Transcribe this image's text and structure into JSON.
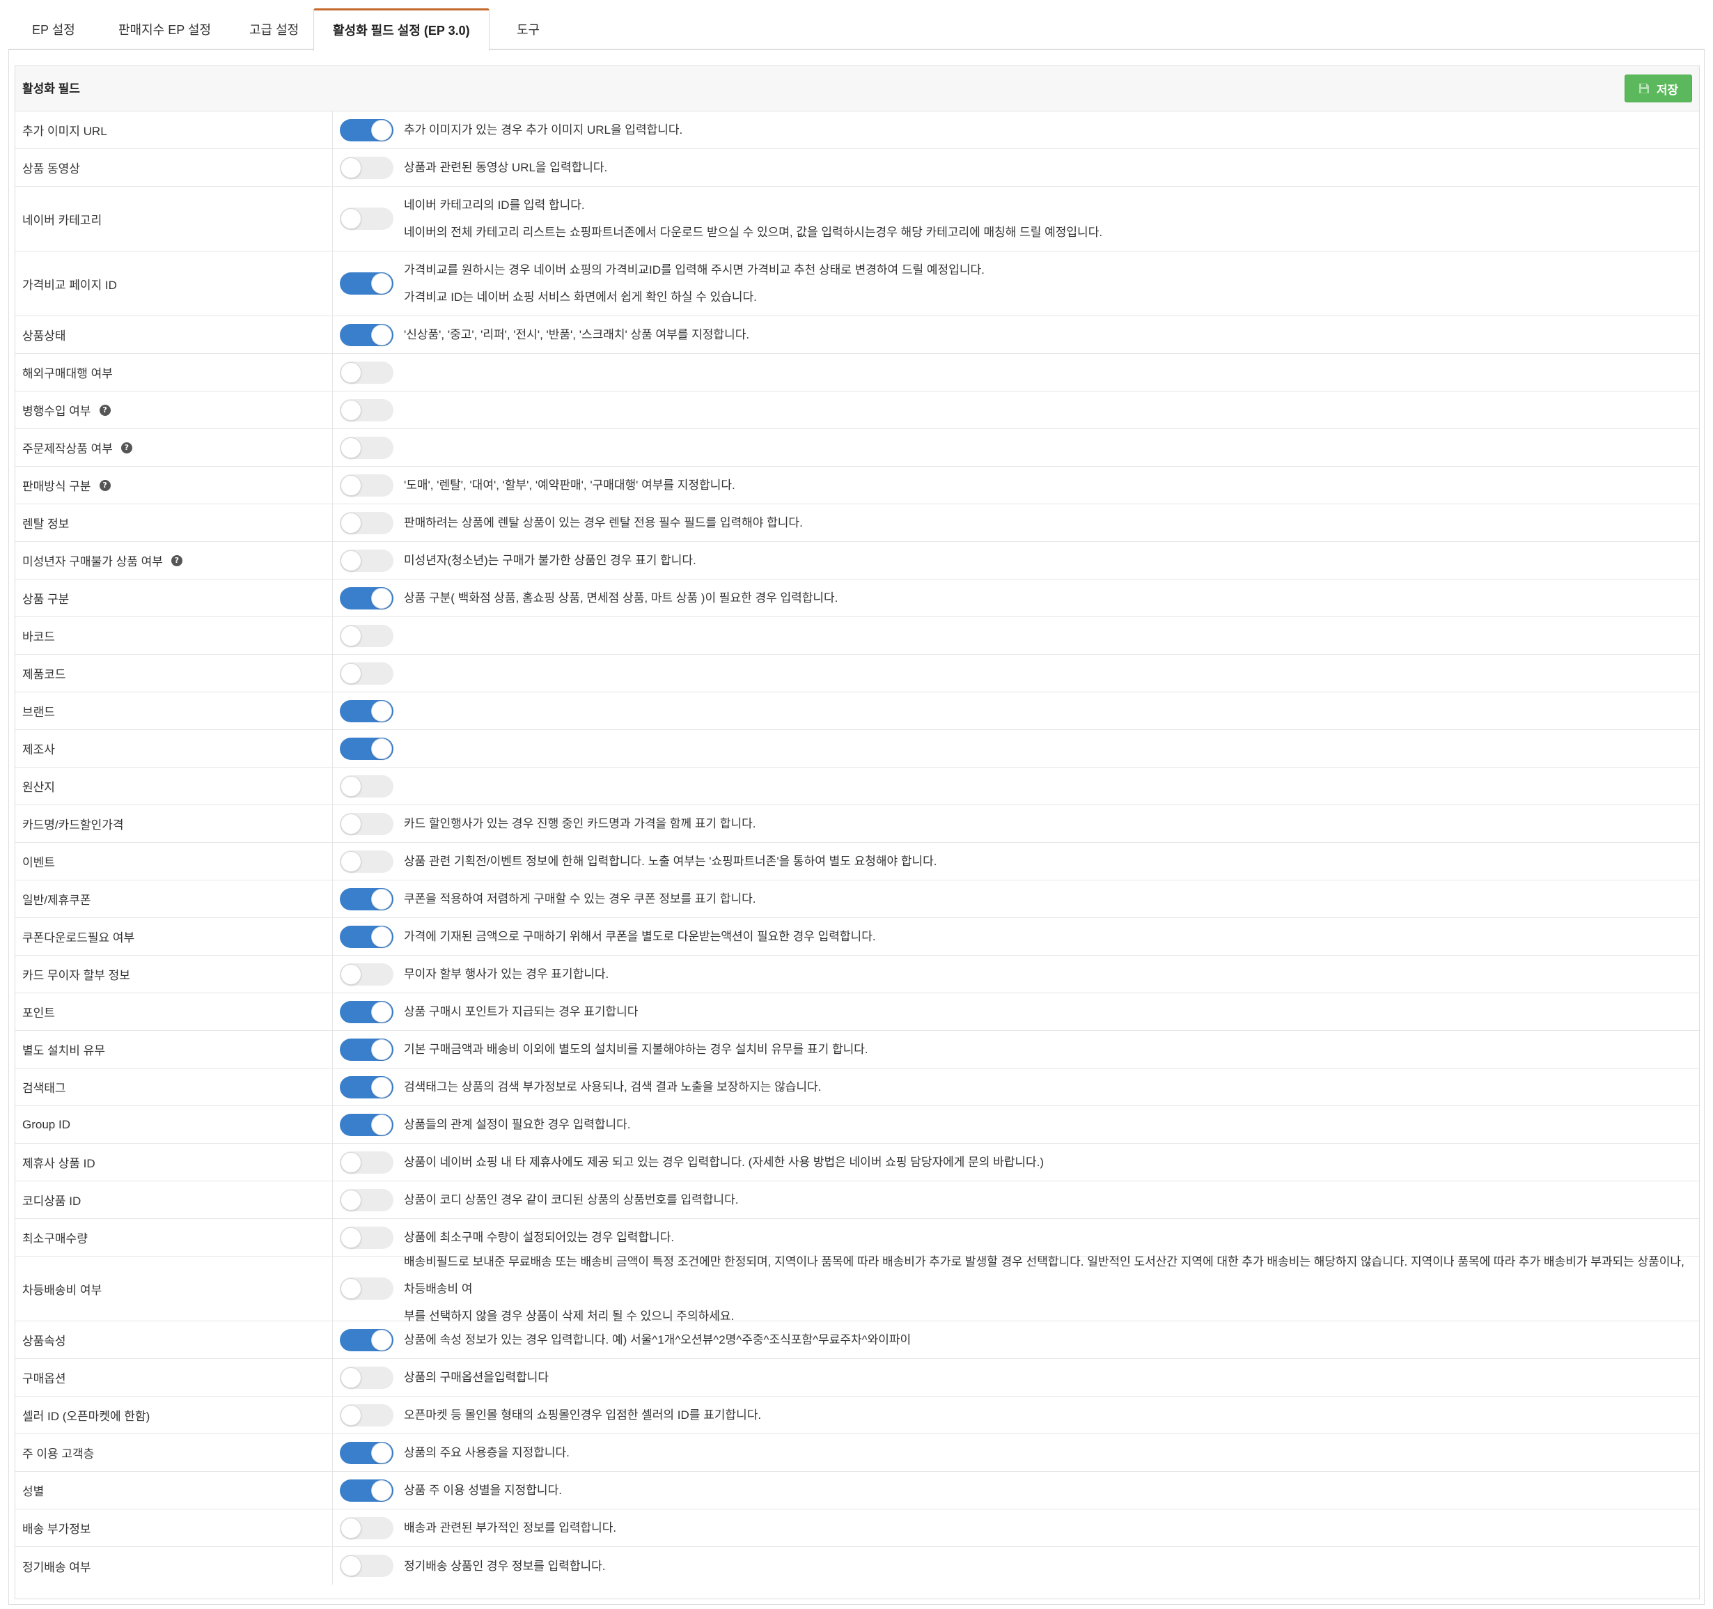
{
  "tabs": [
    {
      "label": "EP 설정",
      "active": false
    },
    {
      "label": "판매지수 EP 설정",
      "active": false
    },
    {
      "label": "고급 설정",
      "active": false
    },
    {
      "label": "활성화 필드 설정 (EP 3.0)",
      "active": true
    },
    {
      "label": "도구",
      "active": false
    }
  ],
  "panel": {
    "title": "활성화 필드",
    "save_label": "저장",
    "save_icon": "floppy-disk-icon",
    "save_color": "#5cb85c",
    "toggle_on_color": "#3a7fcc"
  },
  "fields": [
    {
      "label": "추가 이미지 URL",
      "on": true,
      "help": false,
      "desc": [
        "추가 이미지가 있는 경우 추가 이미지 URL을 입력합니다."
      ]
    },
    {
      "label": "상품 동영상",
      "on": false,
      "help": false,
      "desc": [
        "상품과 관련된 동영상 URL을 입력합니다."
      ]
    },
    {
      "label": "네이버 카테고리",
      "on": false,
      "help": false,
      "desc": [
        "네이버 카테고리의 ID를 입력 합니다.",
        "네이버의 전체 카테고리 리스트는 쇼핑파트너존에서 다운로드 받으실 수 있으며, 값을 입력하시는경우 해당 카테고리에 매칭해 드릴 예정입니다."
      ]
    },
    {
      "label": "가격비교 페이지 ID",
      "on": true,
      "help": false,
      "desc": [
        "가격비교를 원하시는 경우 네이버 쇼핑의 가격비교ID를 입력해 주시면 가격비교 추천 상태로 변경하여 드릴 예정입니다.",
        "가격비교 ID는 네이버 쇼핑 서비스 화면에서 쉽게 확인 하실 수 있습니다."
      ]
    },
    {
      "label": "상품상태",
      "on": true,
      "help": false,
      "desc": [
        "'신상품', '중고', '리퍼', '전시', '반품', '스크래치' 상품 여부를 지정합니다."
      ]
    },
    {
      "label": "해외구매대행 여부",
      "on": false,
      "help": false,
      "desc": []
    },
    {
      "label": "병행수입 여부",
      "on": false,
      "help": true,
      "desc": []
    },
    {
      "label": "주문제작상품 여부",
      "on": false,
      "help": true,
      "desc": []
    },
    {
      "label": "판매방식 구분",
      "on": false,
      "help": true,
      "desc": [
        "'도매', '렌탈', '대여', '할부', '예약판매', '구매대행' 여부를 지정합니다."
      ]
    },
    {
      "label": "렌탈 정보",
      "on": false,
      "help": false,
      "desc": [
        "판매하려는 상품에 렌탈 상품이 있는 경우 렌탈 전용 필수 필드를 입력해야 합니다."
      ]
    },
    {
      "label": "미성년자 구매불가 상품 여부",
      "on": false,
      "help": true,
      "desc": [
        "미성년자(청소년)는 구매가 불가한 상품인 경우 표기 합니다."
      ]
    },
    {
      "label": "상품 구분",
      "on": true,
      "help": false,
      "desc": [
        "상품 구분( 백화점 상품, 홈쇼핑 상품, 면세점 상품, 마트 상품 )이 필요한 경우 입력합니다."
      ]
    },
    {
      "label": "바코드",
      "on": false,
      "help": false,
      "desc": []
    },
    {
      "label": "제품코드",
      "on": false,
      "help": false,
      "desc": []
    },
    {
      "label": "브랜드",
      "on": true,
      "help": false,
      "desc": []
    },
    {
      "label": "제조사",
      "on": true,
      "help": false,
      "desc": []
    },
    {
      "label": "원산지",
      "on": false,
      "help": false,
      "desc": []
    },
    {
      "label": "카드명/카드할인가격",
      "on": false,
      "help": false,
      "desc": [
        "카드 할인행사가 있는 경우 진행 중인 카드명과 가격을 함께 표기 합니다."
      ]
    },
    {
      "label": "이벤트",
      "on": false,
      "help": false,
      "desc": [
        "상품 관련 기획전/이벤트 정보에 한해 입력합니다. 노출 여부는 '쇼핑파트너존'을 통하여 별도 요청해야 합니다."
      ]
    },
    {
      "label": "일반/제휴쿠폰",
      "on": true,
      "help": false,
      "desc": [
        "쿠폰을 적용하여 저렴하게 구매할 수 있는 경우 쿠폰 정보를 표기 합니다."
      ]
    },
    {
      "label": "쿠폰다운로드필요 여부",
      "on": true,
      "help": false,
      "desc": [
        "가격에 기재된 금액으로 구매하기 위해서 쿠폰을 별도로 다운받는액션이 필요한 경우 입력합니다."
      ]
    },
    {
      "label": "카드 무이자 할부 정보",
      "on": false,
      "help": false,
      "desc": [
        "무이자 할부 행사가 있는 경우 표기합니다."
      ]
    },
    {
      "label": "포인트",
      "on": true,
      "help": false,
      "desc": [
        "상품 구매시 포인트가 지급되는 경우 표기합니다"
      ]
    },
    {
      "label": "별도 설치비 유무",
      "on": true,
      "help": false,
      "desc": [
        "기본 구매금액과 배송비 이외에 별도의 설치비를 지불해야하는 경우 설치비 유무를 표기 합니다."
      ]
    },
    {
      "label": "검색태그",
      "on": true,
      "help": false,
      "desc": [
        "검색태그는 상품의 검색 부가정보로 사용되나, 검색 결과 노출을 보장하지는 않습니다."
      ]
    },
    {
      "label": "Group ID",
      "on": true,
      "help": false,
      "desc": [
        "상품들의 관계 설정이 필요한 경우 입력합니다."
      ]
    },
    {
      "label": "제휴사 상품 ID",
      "on": false,
      "help": false,
      "desc": [
        "상품이 네이버 쇼핑 내 타 제휴사에도 제공 되고 있는 경우 입력합니다. (자세한 사용 방법은 네이버 쇼핑 담당자에게 문의 바랍니다.)"
      ]
    },
    {
      "label": "코디상품 ID",
      "on": false,
      "help": false,
      "desc": [
        "상품이 코디 상품인 경우 같이 코디된 상품의 상품번호를 입력합니다."
      ]
    },
    {
      "label": "최소구매수량",
      "on": false,
      "help": false,
      "desc": [
        "상품에 최소구매 수량이 설정되어있는 경우 입력합니다."
      ]
    },
    {
      "label": "차등배송비 여부",
      "on": false,
      "help": false,
      "desc": [
        "배송비필드로 보내준 무료배송 또는 배송비 금액이 특정 조건에만 한정되며, 지역이나 품목에 따라 배송비가 추가로 발생할 경우 선택합니다. 일반적인 도서산간 지역에 대한 추가 배송비는 해당하지 않습니다. 지역이나 품목에 따라 추가 배송비가 부과되는 상품이나, 차등배송비 여",
        "부를 선택하지 않을 경우 상품이 삭제 처리 될 수 있으니 주의하세요."
      ]
    },
    {
      "label": "상품속성",
      "on": true,
      "help": false,
      "desc": [
        "상품에 속성 정보가 있는 경우 입력합니다. 예) 서울^1개^오션뷰^2명^주중^조식포함^무료주차^와이파이"
      ]
    },
    {
      "label": "구매옵션",
      "on": false,
      "help": false,
      "desc": [
        "상품의 구매옵션을입력합니다"
      ]
    },
    {
      "label": "셀러 ID (오픈마켓에 한함)",
      "on": false,
      "help": false,
      "desc": [
        "오픈마켓 등 몰인몰 형태의 쇼핑몰인경우 입점한 셀러의 ID를 표기합니다."
      ]
    },
    {
      "label": "주 이용 고객층",
      "on": true,
      "help": false,
      "desc": [
        "상품의 주요 사용층을 지정합니다."
      ]
    },
    {
      "label": "성별",
      "on": true,
      "help": false,
      "desc": [
        "상품 주 이용 성별을 지정합니다."
      ]
    },
    {
      "label": "배송 부가정보",
      "on": false,
      "help": false,
      "desc": [
        "배송과 관련된 부가적인 정보를 입력합니다."
      ]
    },
    {
      "label": "정기배송 여부",
      "on": false,
      "help": false,
      "desc": [
        "정기배송 상품인 경우 정보를 입력합니다."
      ]
    }
  ]
}
